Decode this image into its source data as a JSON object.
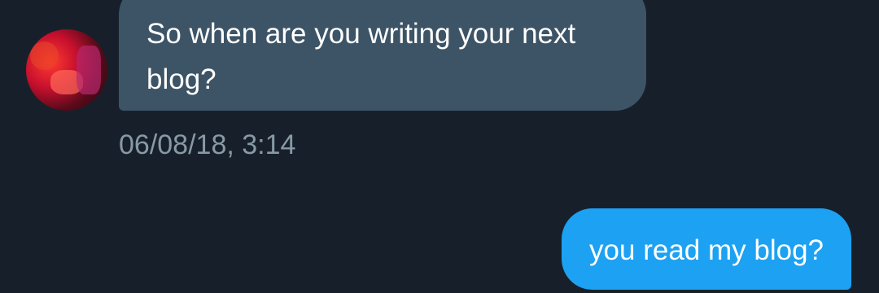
{
  "messages": [
    {
      "direction": "incoming",
      "text": "So when are you writing your next blog?",
      "timestamp": "06/08/18, 3:14"
    },
    {
      "direction": "outgoing",
      "text": "you read my blog?"
    }
  ],
  "colors": {
    "background": "#17202a",
    "incoming_bubble": "#3d5466",
    "outgoing_bubble": "#1da1f2",
    "timestamp_text": "#8899a6",
    "message_text": "#ffffff"
  }
}
